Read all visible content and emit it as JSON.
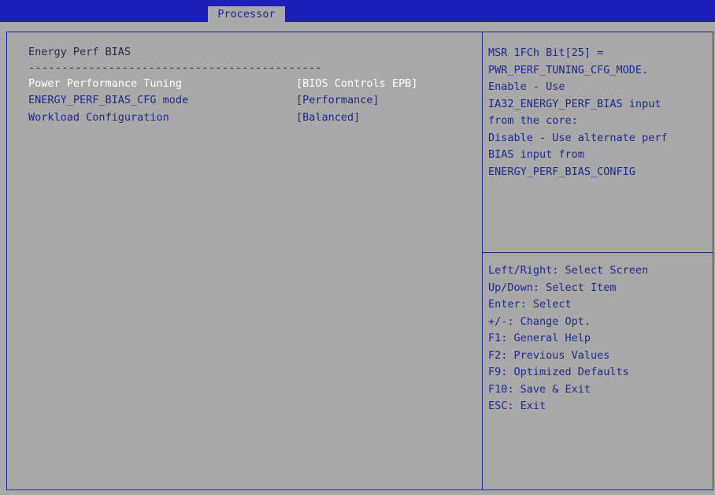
{
  "topbar": {
    "tab": "Processor"
  },
  "main": {
    "title": "Energy Perf BIAS",
    "separator": "--------------------------------------------",
    "items": [
      {
        "label": "Power Performance Tuning",
        "value": "[BIOS Controls EPB]",
        "selected": true
      },
      {
        "label": "ENERGY_PERF_BIAS_CFG mode",
        "value": "[Performance]",
        "selected": false
      },
      {
        "label": "Workload Configuration",
        "value": "[Balanced]",
        "selected": false
      }
    ]
  },
  "help": {
    "lines": [
      "MSR 1FCh Bit[25] =",
      "PWR_PERF_TUNING_CFG_MODE.",
      "Enable - Use",
      "IA32_ENERGY_PERF_BIAS input",
      "from the core:",
      "Disable - Use alternate perf",
      "BIAS input from",
      "ENERGY_PERF_BIAS_CONFIG"
    ]
  },
  "keys": {
    "lines": [
      "Left/Right: Select Screen",
      "Up/Down: Select Item",
      "Enter: Select",
      "+/-: Change Opt.",
      "F1: General Help",
      "F2: Previous Values",
      "F9: Optimized Defaults",
      "F10: Save & Exit",
      "ESC: Exit"
    ]
  },
  "colors": {
    "background": "#a8a8a8",
    "topbar": "#1d1fb8",
    "text": "#1e2a8c",
    "selected_text": "#ffffff"
  }
}
